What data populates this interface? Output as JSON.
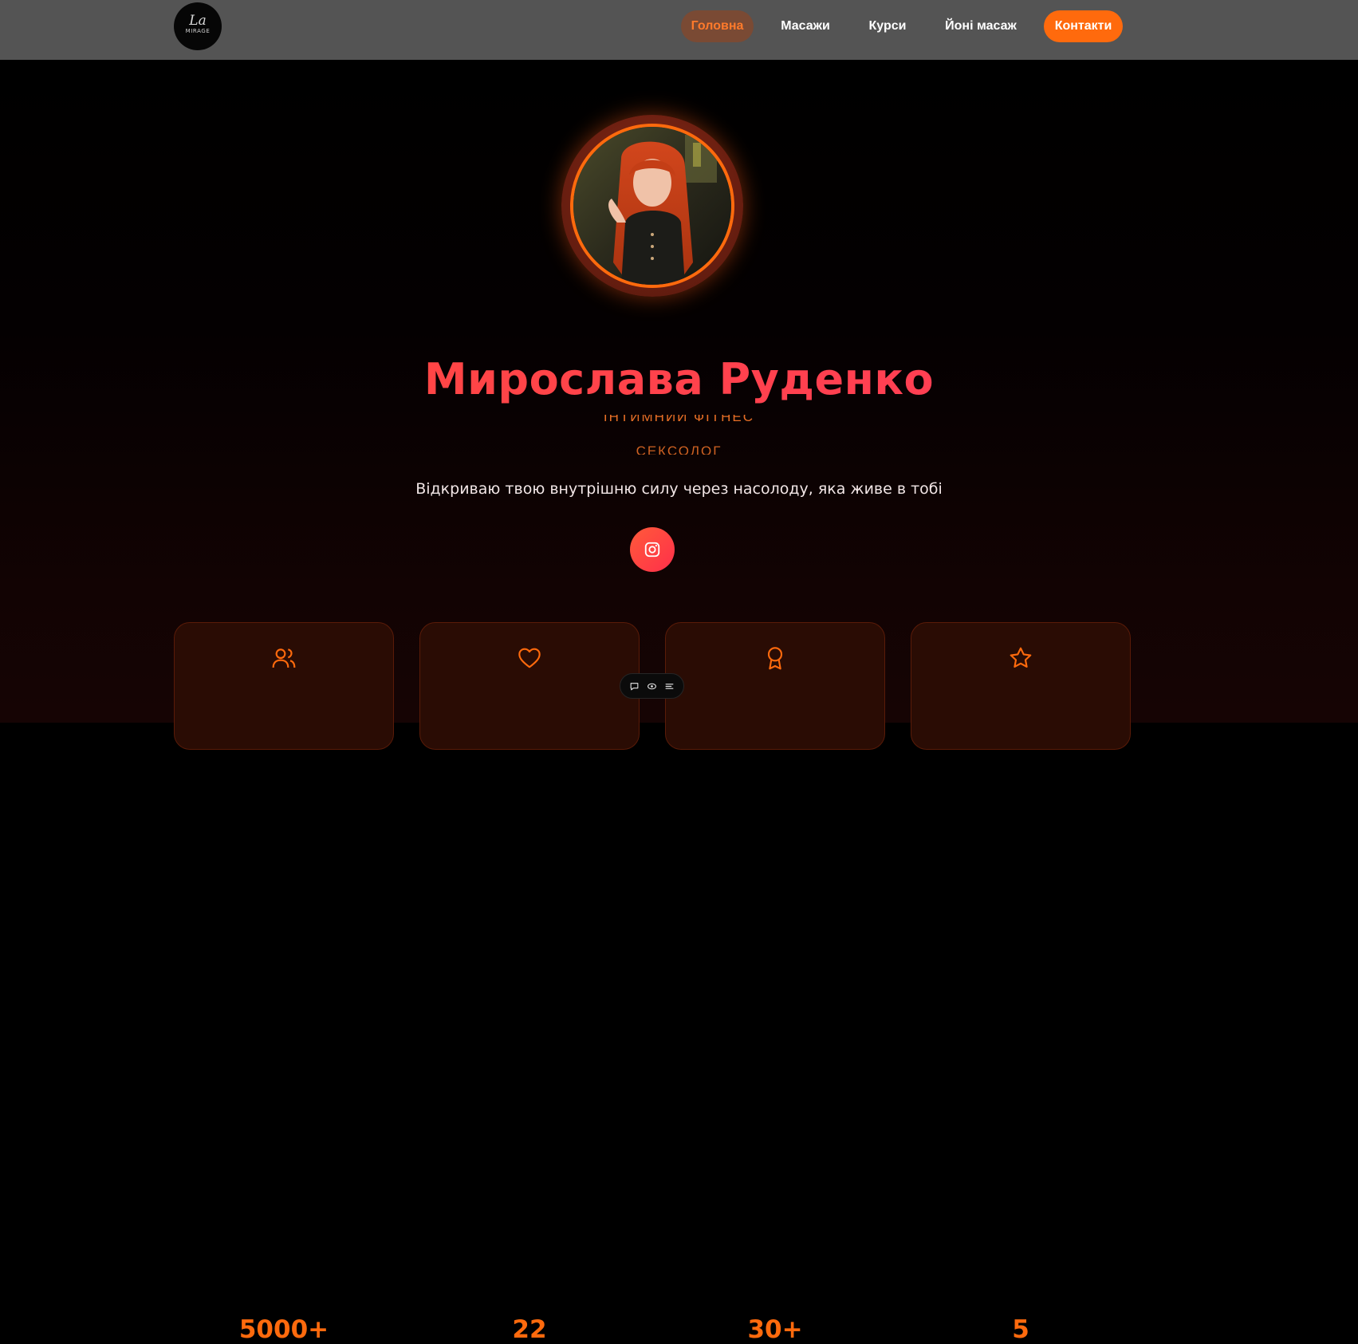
{
  "logo": {
    "script": "La",
    "word": "MIRAGE"
  },
  "nav": {
    "home": "Головна",
    "massages": "Масажи",
    "courses": "Курси",
    "yoni": "Йоні масаж",
    "contacts": "Контакти"
  },
  "hero": {
    "name": "Мирослава Руденко",
    "roles": [
      "ІНТИМНИЙ ФІТНЕС",
      "СЕКСОЛОГ"
    ],
    "tagline": "Відкриваю твою внутрішню силу через насолоду, яка живе в тобі"
  },
  "stats": [
    {
      "icon": "users-icon",
      "value": "5000+"
    },
    {
      "icon": "heart-icon",
      "value": "22"
    },
    {
      "icon": "award-icon",
      "value": "30+"
    },
    {
      "icon": "star-icon",
      "value": "5"
    }
  ],
  "colors": {
    "accent": "#ff6a0d",
    "name_gradient_start": "#ff4a3a",
    "name_gradient_end": "#ff3a5e",
    "navbar_bg": "#545454",
    "card_bg": "#2a0c04"
  }
}
